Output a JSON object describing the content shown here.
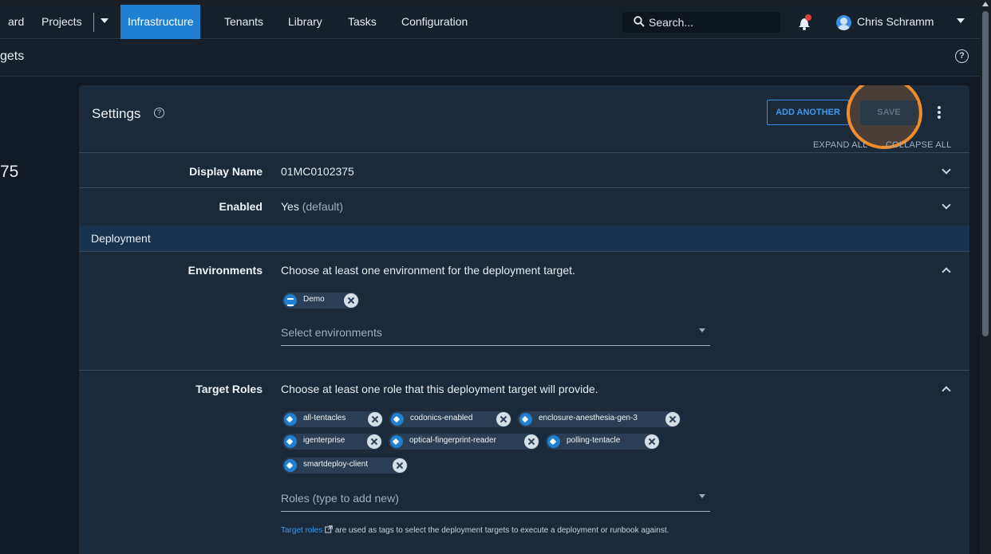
{
  "nav": {
    "items": [
      "ard",
      "Projects",
      "Infrastructure",
      "Tenants",
      "Library",
      "Tasks",
      "Configuration"
    ],
    "active": "Infrastructure",
    "search_placeholder": "Search...",
    "user_name": "Chris Schramm"
  },
  "subheader": {
    "title": "gets"
  },
  "side_number": "75",
  "settings": {
    "title": "Settings",
    "add_another": "ADD ANOTHER",
    "save": "SAVE",
    "expand_all": "EXPAND ALL",
    "collapse_all": "COLLAPSE ALL"
  },
  "rows": {
    "display_name": {
      "label": "Display Name",
      "value": "01MC0102375"
    },
    "enabled": {
      "label": "Enabled",
      "value": "Yes",
      "suffix": "(default)"
    }
  },
  "section": {
    "title": "Deployment"
  },
  "environments": {
    "label": "Environments",
    "description": "Choose at least one environment for the deployment target.",
    "chips": [
      "Demo"
    ],
    "placeholder": "Select environments"
  },
  "target_roles": {
    "label": "Target Roles",
    "description": "Choose at least one role that this deployment target will provide.",
    "chips": [
      "all-tentacles",
      "codonics-enabled",
      "enclosure-anesthesia-gen-3",
      "igenterprise",
      "optical-fingerprint-reader",
      "polling-tentacle",
      "smartdeploy-client"
    ],
    "placeholder": "Roles (type to add new)",
    "help_link": "Target roles",
    "help_text": "are used as tags to select the deployment targets to execute a deployment or runbook against."
  },
  "colors": {
    "accent": "#1f7fd0",
    "highlight": "#f08c2c",
    "background": "#111a24",
    "card": "#1a2a3b"
  }
}
